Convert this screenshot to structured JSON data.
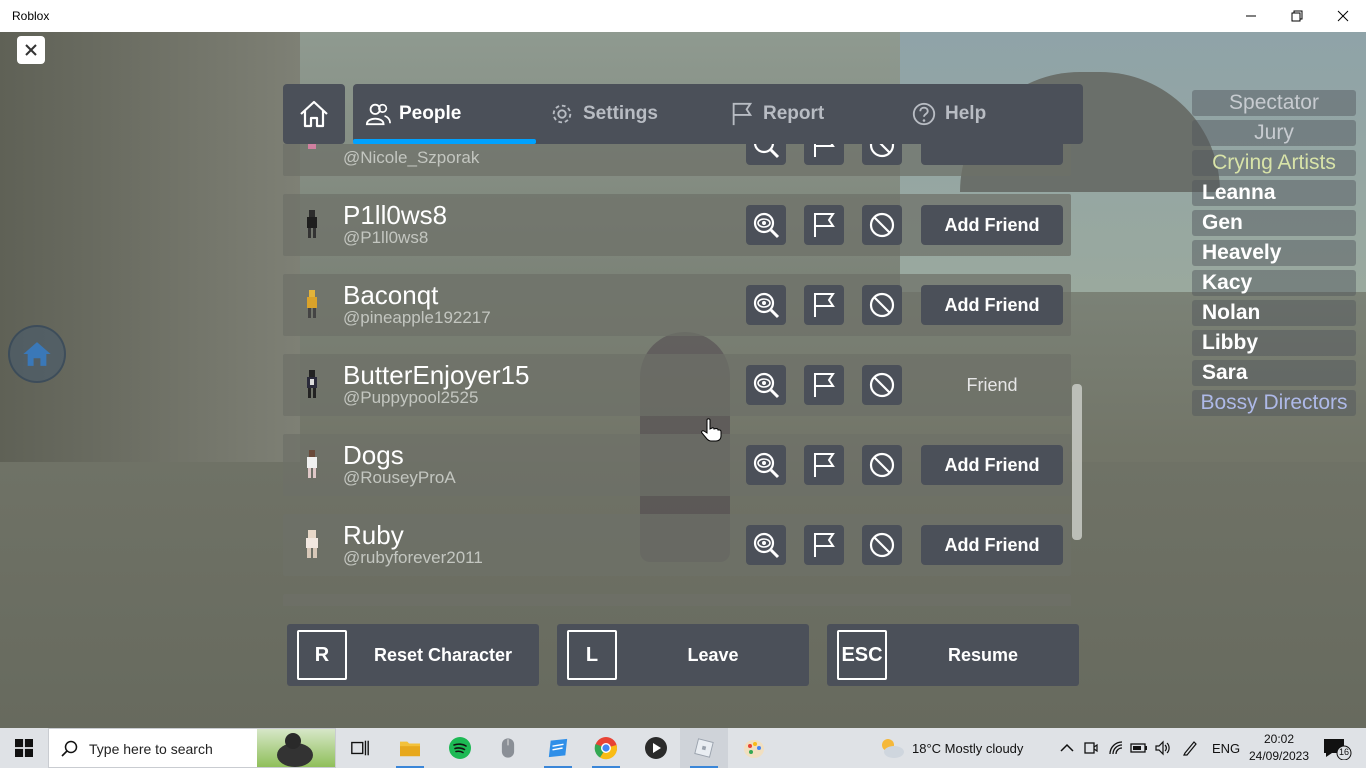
{
  "window": {
    "title": "Roblox"
  },
  "tabs": [
    {
      "label": "People"
    },
    {
      "label": "Settings"
    },
    {
      "label": "Report"
    },
    {
      "label": "Help"
    }
  ],
  "people": [
    {
      "display": "",
      "username": "@Nicole_Szporak",
      "friend_label": "",
      "is_friend": false
    },
    {
      "display": "P1ll0ws8",
      "username": "@P1ll0ws8",
      "friend_label": "Add Friend",
      "is_friend": false
    },
    {
      "display": "Baconqt",
      "username": "@pineapple192217",
      "friend_label": "Add Friend",
      "is_friend": false
    },
    {
      "display": "ButterEnjoyer15",
      "username": "@Puppypool2525",
      "friend_label": "Friend",
      "is_friend": true
    },
    {
      "display": "Dogs",
      "username": "@RouseyProA",
      "friend_label": "Add Friend",
      "is_friend": false
    },
    {
      "display": "Ruby",
      "username": "@rubyforever2011",
      "friend_label": "Add Friend",
      "is_friend": false
    }
  ],
  "bottom": {
    "reset": {
      "key": "R",
      "label": "Reset Character"
    },
    "leave": {
      "key": "L",
      "label": "Leave"
    },
    "resume": {
      "key": "ESC",
      "label": "Resume"
    }
  },
  "player_list": [
    {
      "name": "Spectator",
      "team": true,
      "color": "#c7cbd0"
    },
    {
      "name": "Jury",
      "team": true,
      "color": "#c7cbd0"
    },
    {
      "name": "Crying Artists",
      "team": true,
      "color": "#d8e3a8"
    },
    {
      "name": "Leanna",
      "team": false,
      "color": "#ffffff"
    },
    {
      "name": "Gen",
      "team": false,
      "color": "#ffffff"
    },
    {
      "name": "Heavely",
      "team": false,
      "color": "#ffffff"
    },
    {
      "name": "Kacy",
      "team": false,
      "color": "#ffffff"
    },
    {
      "name": "Nolan",
      "team": false,
      "color": "#ffffff"
    },
    {
      "name": "Libby",
      "team": false,
      "color": "#ffffff"
    },
    {
      "name": "Sara",
      "team": false,
      "color": "#ffffff"
    },
    {
      "name": "Bossy Directors",
      "team": true,
      "color": "#aeb9e8"
    }
  ],
  "taskbar": {
    "search_placeholder": "Type here to search",
    "weather": "18°C  Mostly cloudy",
    "language": "ENG",
    "time": "20:02",
    "date": "24/09/2023",
    "notifications": "16"
  },
  "colors": {
    "accent": "#00a2ff",
    "panel": "#4b5059"
  }
}
